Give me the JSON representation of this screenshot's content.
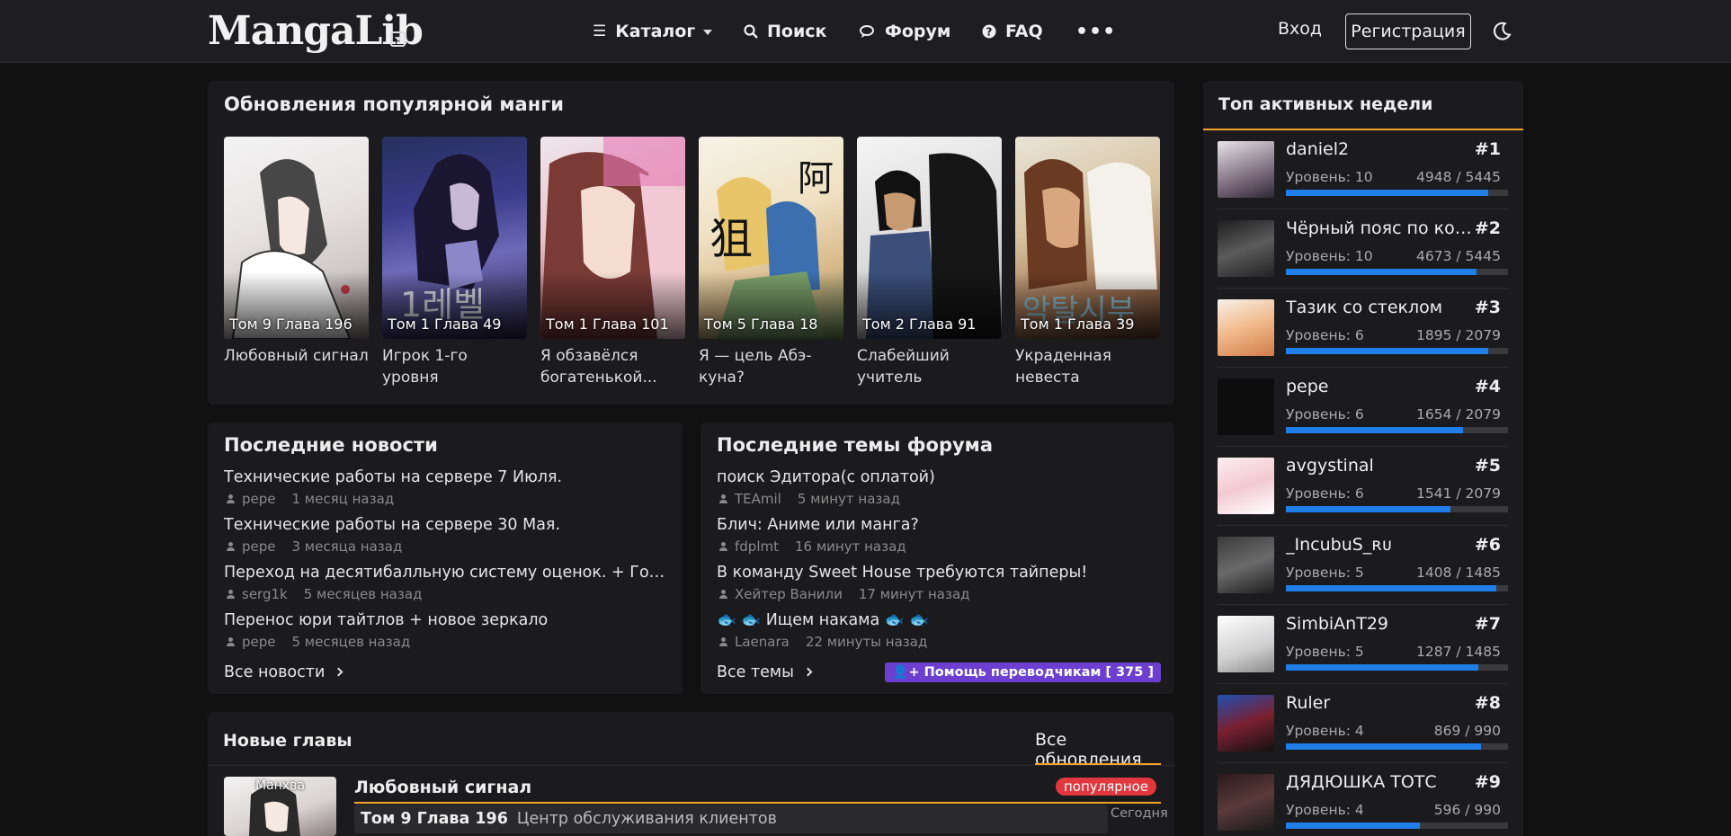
{
  "header": {
    "logo": "MangaLib",
    "nav": {
      "catalog": "Каталог",
      "search": "Поиск",
      "forum": "Форум",
      "faq": "FAQ",
      "more": "•••"
    },
    "login": "Вход",
    "register": "Регистрация"
  },
  "popular": {
    "title": "Обновления популярной манги",
    "items": [
      {
        "chapter": "Том 9 Глава 196",
        "title": "Любовный сигнал"
      },
      {
        "chapter": "Том 1 Глава 49",
        "title": "Игрок 1-го уровня"
      },
      {
        "chapter": "Том 1 Глава 101",
        "title": "Я обзавёлся богатенькой..."
      },
      {
        "chapter": "Том 5 Глава 18",
        "title": "Я — цель Абэ-куна?"
      },
      {
        "chapter": "Том 2 Глава 91",
        "title": "Слабейший учитель"
      },
      {
        "chapter": "Том 1 Глава 39",
        "title": "Украденная невеста"
      }
    ]
  },
  "news": {
    "title": "Последние новости",
    "items": [
      {
        "title": "Технические работы на сервере 7 Июля.",
        "user": "pepe",
        "time": "1 месяц назад"
      },
      {
        "title": "Технические работы на сервере 30 Мая.",
        "user": "pepe",
        "time": "3 месяца назад"
      },
      {
        "title": "Переход на десятибалльную систему оценок. + Голосов...",
        "user": "serg1k",
        "time": "5 месяцев назад"
      },
      {
        "title": "Перенос юри тайтлов + новое зеркало",
        "user": "pepe",
        "time": "5 месяцев назад"
      }
    ],
    "all_link": "Все новости"
  },
  "forum": {
    "title": "Последние темы форума",
    "items": [
      {
        "title": "поиск Эдитора(с оплатой)",
        "user": "TEAmil",
        "time": "5 минут назад"
      },
      {
        "title": "Блич: Аниме или манга?",
        "user": "fdplmt",
        "time": "16 минут назад"
      },
      {
        "title": "В команду Sweet House требуются тайперы!",
        "user": "Хейтер Ванили",
        "time": "17 минут назад"
      },
      {
        "title": "🐟 🐟 Ищем накама 🐟 🐟",
        "user": "Laenara",
        "time": "22 минуты назад"
      }
    ],
    "all_link": "Все темы",
    "help_button": "Помощь переводчикам [ 375 ]"
  },
  "chapters": {
    "title": "Новые главы",
    "tab": "Все обновления",
    "item": {
      "type": "Манхва",
      "title": "Любовный сигнал",
      "badge": "популярное",
      "chapter": "Том 9 Глава 196",
      "chapter_name": "Центр обслуживания клиентов",
      "date": "Сегодня"
    }
  },
  "top_week": {
    "title": "Топ активных недели",
    "users": [
      {
        "name": "daniel2",
        "rank": "#1",
        "level": "Уровень: 10",
        "xp": "4948 / 5445",
        "progress": 0.909
      },
      {
        "name": "Чёрный пояс по коммуникациям",
        "rank": "#2",
        "level": "Уровень: 10",
        "xp": "4673 / 5445",
        "progress": 0.858
      },
      {
        "name": "Тазик со стеклом",
        "rank": "#3",
        "level": "Уровень: 6",
        "xp": "1895 / 2079",
        "progress": 0.912
      },
      {
        "name": "pepe",
        "rank": "#4",
        "level": "Уровень: 6",
        "xp": "1654 / 2079",
        "progress": 0.796
      },
      {
        "name": "avgystinal",
        "rank": "#5",
        "level": "Уровень: 6",
        "xp": "1541 / 2079",
        "progress": 0.741
      },
      {
        "name": "_IncubuS_ʀᴜ",
        "rank": "#6",
        "level": "Уровень: 5",
        "xp": "1408 / 1485",
        "progress": 0.948
      },
      {
        "name": "SimbiAnT29",
        "rank": "#7",
        "level": "Уровень: 5",
        "xp": "1287 / 1485",
        "progress": 0.867
      },
      {
        "name": "Ruler",
        "rank": "#8",
        "level": "Уровень: 4",
        "xp": "869 / 990",
        "progress": 0.878
      },
      {
        "name": "ДЯДЮШКА ТОТС",
        "rank": "#9",
        "level": "Уровень: 4",
        "xp": "596 / 990",
        "progress": 0.602
      }
    ]
  },
  "colors": {
    "accent": "#f4a12b",
    "progress": "#1f7ee8",
    "badge": "#e0383e",
    "help": "#6c3fd1"
  }
}
